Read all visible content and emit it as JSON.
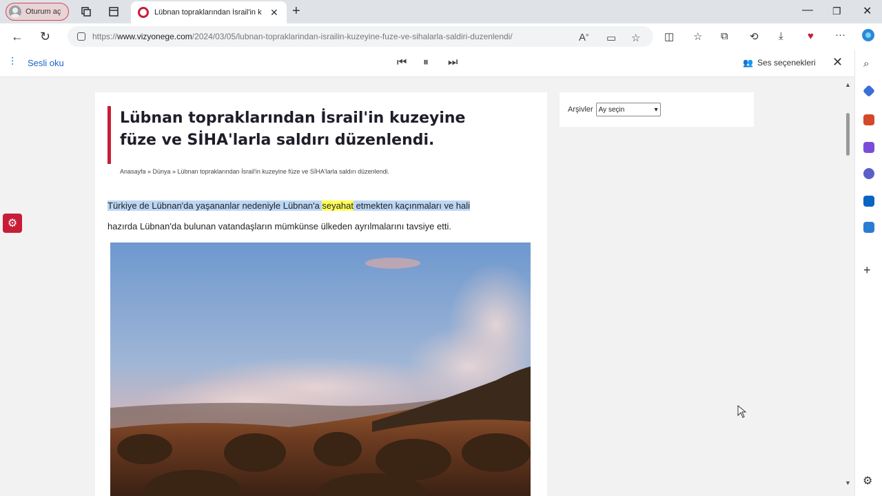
{
  "tabstrip": {
    "profile_label": "Oturum aç",
    "active_tab_title": "Lübnan topraklarından İsrail'in k",
    "new_tab": "+"
  },
  "window_controls": {
    "minimize": "—",
    "restore": "❐",
    "close": "✕"
  },
  "navbar": {
    "url_prefix": "https://",
    "url_domain": "www.vizyonege.com",
    "url_path": "/2024/03/05/lubnan-topraklarindan-israilin-kuzeyine-fuze-ve-sihalarla-saldiri-duzenlendi/"
  },
  "read_aloud": {
    "label": "Sesli oku",
    "voice_options": "Ses seçenekleri"
  },
  "article": {
    "headline": "Lübnan topraklarından İsrail'in kuzeyine füze ve SİHA'larla saldırı düzenlendi.",
    "breadcrumb": "Anasayfa » Dünya » Lübnan topraklarından İsrail'in kuzeyine füze ve SİHA'larla saldırı düzenlendi.",
    "lead_highlight_1": "Türkiye de Lübnan'da yaşananlar nedeniyle Lübnan'a ",
    "lead_highlight_word": "seyahat",
    "lead_highlight_2": " etmekten kaçınmaları ve hali",
    "lead_rest": "hazırda Lübnan'da bulunan vatandaşların mümkünse ülkeden ayrılmalarını tavsiye etti."
  },
  "sidebar": {
    "archive_label": "Arşivler",
    "archive_select": "Ay seçin"
  },
  "colors": {
    "brand": "#c81d37",
    "highlight": "#bcd6f5",
    "current_word": "#ffff5a",
    "read_aloud": "#1a62c9"
  }
}
